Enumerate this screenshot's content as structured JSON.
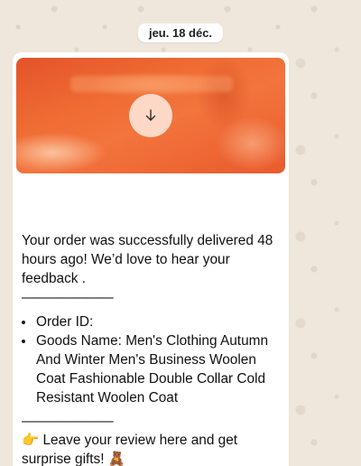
{
  "chat": {
    "date_label": "jeu. 18 déc."
  },
  "message": {
    "intro": "Your order was successfully delivered 48 hours ago! We’d love to hear your feedback .",
    "divider": "———————",
    "details": [
      {
        "text": "Order ID:"
      },
      {
        "text": "Goods Name: Men's Clothing Autumn And Winter Men's Business Woolen Coat Fashionable Double Collar Cold Resistant Woolen Coat"
      }
    ],
    "cta": "👉 Leave your review here and get surprise gifts! 🧸"
  },
  "media": {
    "download_icon": "arrow-down-icon",
    "accent_color": "#e85a2c"
  }
}
